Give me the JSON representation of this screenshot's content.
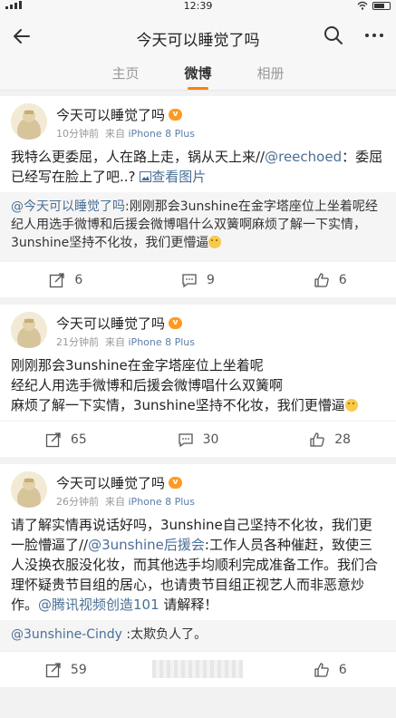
{
  "status_bar": {
    "time": "12:39"
  },
  "nav": {
    "title": "今天可以睡觉了吗"
  },
  "tabs": [
    {
      "label": "主页"
    },
    {
      "label": "微博"
    },
    {
      "label": "相册"
    }
  ],
  "posts": [
    {
      "user": "今天可以睡觉了吗",
      "time": "10分钟前",
      "from_label": "来自",
      "source": "iPhone 8 Plus",
      "text_1": "我特么更委屈，人在路上走，锅从天上来//",
      "mention": "@reechoed",
      "text_2": "：委屈已经写在脸上了吧..?",
      "view_images": "查看图片",
      "repost_user": "@今天可以睡觉了吗",
      "repost_text": ":刚刚那会3unshine在金字塔座位上坐着呢经纪人用选手微博和后援会微博唱什么双簧啊麻烦了解一下实情，3unshine坚持不化妆，我们更懵逼",
      "reposts": "6",
      "comments": "9",
      "likes": "6"
    },
    {
      "user": "今天可以睡觉了吗",
      "time": "21分钟前",
      "from_label": "来自",
      "source": "iPhone 8 Plus",
      "line_1": "刚刚那会3unshine在金字塔座位上坐着呢",
      "line_2": "经纪人用选手微博和后援会微博唱什么双簧啊",
      "line_3": "麻烦了解一下实情，3unshine坚持不化妆，我们更懵逼",
      "reposts": "65",
      "comments": "30",
      "likes": "28"
    },
    {
      "user": "今天可以睡觉了吗",
      "time": "26分钟前",
      "from_label": "来自",
      "source": "iPhone 8 Plus",
      "text_1": "请了解实情再说话好吗，3unshine自己坚持不化妆，我们更一脸懵逼了//",
      "mention_1": "@3unshine后援会",
      "text_2": ":工作人员各种催赶，致使三人没换衣服没化妆，而其他选手均顺利完成准备工作。我们合理怀疑贵节目组的居心，也请贵节目组正视艺人而非恶意炒作。",
      "mention_2": "@腾讯视频创造101",
      "text_3": " 请解释！",
      "repost_user": "@3unshine-Cindy",
      "repost_text": " :太欺负人了。",
      "reposts": "59",
      "likes": "6"
    }
  ],
  "colors": {
    "accent": "#ff8200",
    "link": "#4a6f96"
  }
}
